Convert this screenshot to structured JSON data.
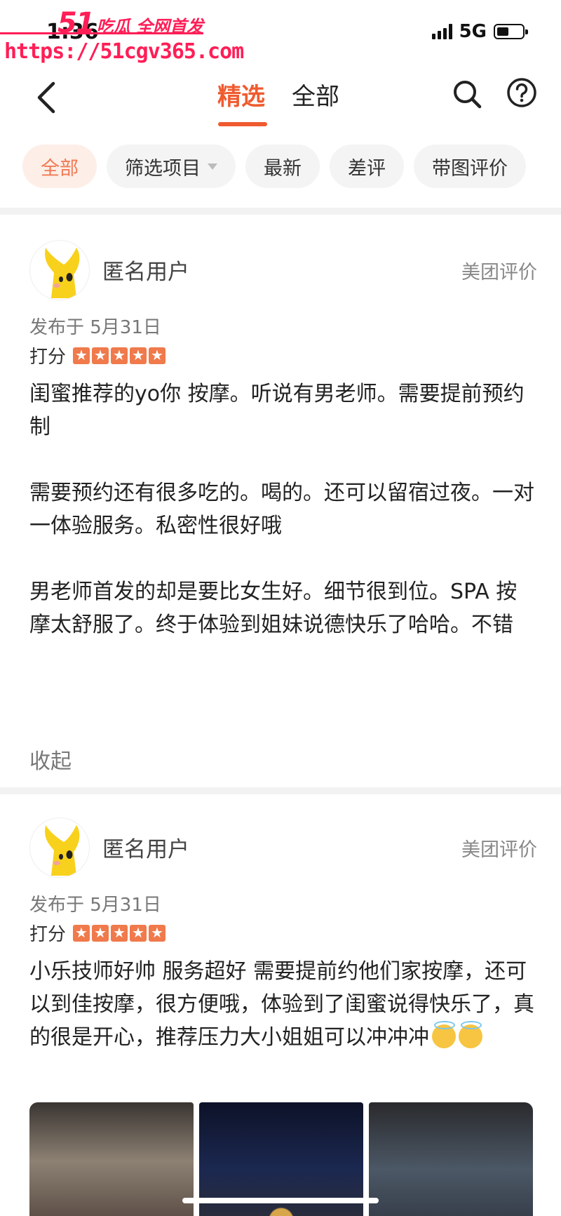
{
  "status": {
    "time": "1:36",
    "network": "5G"
  },
  "watermark": {
    "brand_num": "51",
    "brand_text": "吃瓜 全网首发",
    "url": "https://51cgv365.com"
  },
  "header": {
    "tab_selected": "精选",
    "tab_all": "全部"
  },
  "filters": [
    {
      "label": "全部",
      "active": true
    },
    {
      "label": "筛选项目",
      "dropdown": true
    },
    {
      "label": "最新"
    },
    {
      "label": "差评"
    },
    {
      "label": "带图评价"
    }
  ],
  "reviews": [
    {
      "user": "匿名用户",
      "source": "美团评价",
      "date": "发布于 5月31日",
      "rating_label": "打分",
      "stars": 5,
      "paragraphs": [
        "闺蜜推荐的yo你 按摩。听说有男老师。需要提前预约制",
        "需要预约还有很多吃的。喝的。还可以留宿过夜。一对一体验服务。私密性很好哦",
        "男老师首发的却是要比女生好。细节很到位。SPA 按摩太舒服了。终于体验到姐妹说德快乐了哈哈。不错"
      ],
      "collapse": "收起"
    },
    {
      "user": "匿名用户",
      "source": "美团评价",
      "date": "发布于 5月31日",
      "rating_label": "打分",
      "stars": 5,
      "text": "小乐技师好帅  服务超好  需要提前约他们家按摩，还可以到佳按摩，很方便哦，体验到了闺蜜说得快乐了，真的很是开心，推荐压力大小姐姐可以冲冲冲"
    }
  ]
}
